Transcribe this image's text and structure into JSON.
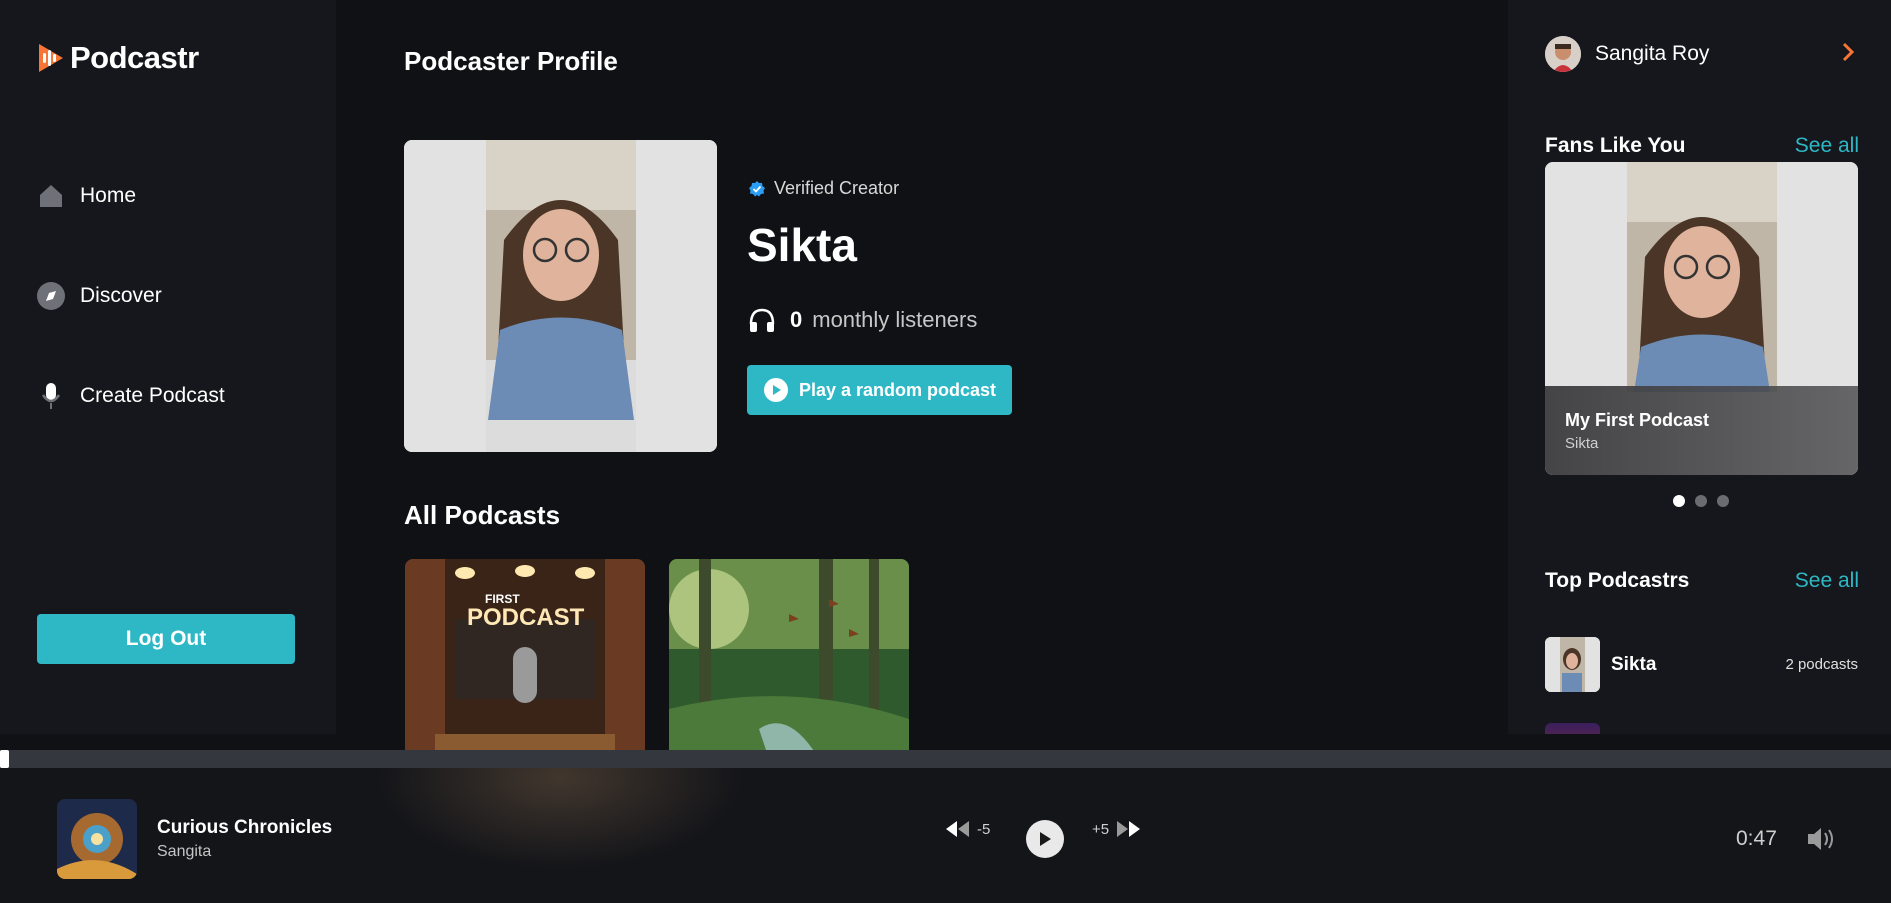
{
  "app": {
    "name": "Podcastr"
  },
  "sidebar": {
    "items": [
      {
        "label": "Home",
        "icon": "home-icon"
      },
      {
        "label": "Discover",
        "icon": "compass-icon"
      },
      {
        "label": "Create Podcast",
        "icon": "microphone-icon"
      }
    ],
    "logout_label": "Log Out"
  },
  "profile": {
    "page_title": "Podcaster Profile",
    "verified_label": "Verified Creator",
    "name": "Sikta",
    "listeners_count": "0",
    "listeners_label": "monthly listeners",
    "play_random_label": "Play a random podcast"
  },
  "podcasts": {
    "section_title": "All Podcasts",
    "cards": [
      {
        "thumb_text_1": "FIRST",
        "thumb_text_2": "PODCAST"
      },
      {
        "thumb_text_1": "",
        "thumb_text_2": ""
      }
    ]
  },
  "right": {
    "user_name": "Sangita Roy",
    "fans": {
      "title": "Fans Like You",
      "see_all": "See all",
      "card_title": "My First Podcast",
      "card_author": "Sikta",
      "active_dot": 0
    },
    "top": {
      "title": "Top Podcastrs",
      "see_all": "See all",
      "rows": [
        {
          "name": "Sikta",
          "count": "2 podcasts"
        }
      ]
    }
  },
  "player": {
    "title": "Curious Chronicles",
    "artist": "Sangita",
    "back_label": "-5",
    "forward_label": "+5",
    "time": "0:47",
    "progress": 0
  },
  "colors": {
    "accent": "#2eb8c6",
    "logo": "#f97535",
    "verified": "#2a9df4"
  }
}
